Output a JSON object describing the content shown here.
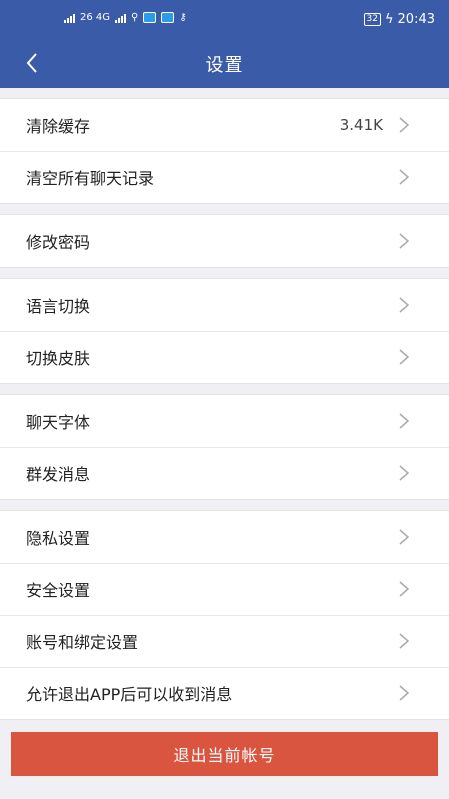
{
  "status_bar": {
    "network_label": "26 4G",
    "battery": "32",
    "time": "20:43"
  },
  "header": {
    "title": "设置"
  },
  "groups": [
    {
      "items": [
        {
          "label": "清除缓存",
          "value": "3.41K"
        },
        {
          "label": "清空所有聊天记录"
        }
      ]
    },
    {
      "items": [
        {
          "label": "修改密码"
        }
      ]
    },
    {
      "items": [
        {
          "label": "语言切换"
        },
        {
          "label": "切换皮肤"
        }
      ]
    },
    {
      "items": [
        {
          "label": "聊天字体"
        },
        {
          "label": "群发消息"
        }
      ]
    },
    {
      "items": [
        {
          "label": "隐私设置"
        },
        {
          "label": "安全设置"
        },
        {
          "label": "账号和绑定设置"
        },
        {
          "label": "允许退出APP后可以收到消息"
        }
      ]
    }
  ],
  "logout_label": "退出当前帐号",
  "colors": {
    "header_bg": "#3a5ca8",
    "logout_bg": "#d9553f",
    "page_bg": "#efeff4"
  },
  "icons": {
    "back": "chevron-left-icon",
    "row": "chevron-right-icon"
  }
}
